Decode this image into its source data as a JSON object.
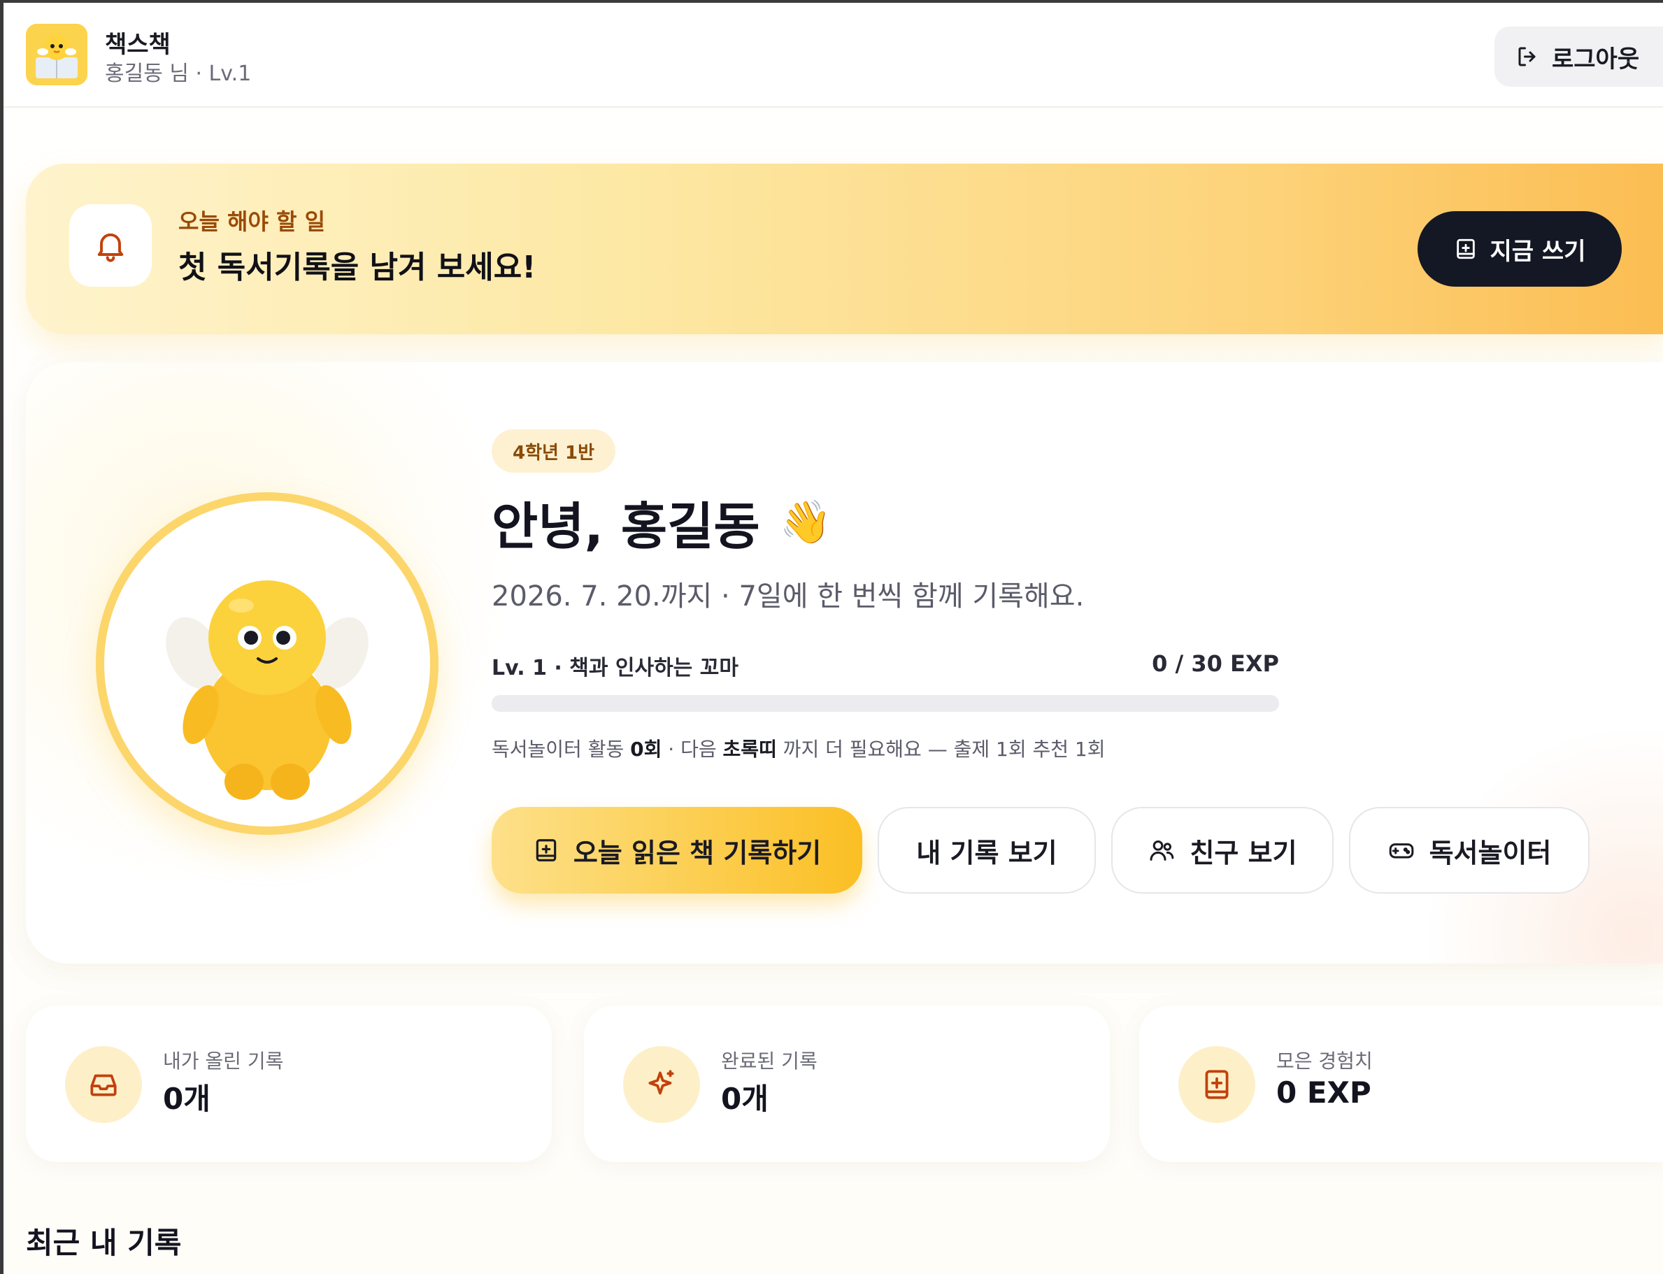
{
  "header": {
    "app_name": "책스책",
    "user_line": "홍길동 님 · Lv.1",
    "logout_label": "로그아웃"
  },
  "todo": {
    "kicker": "오늘 해야 할 일",
    "title": "첫 독서기록을 남겨 보세요!",
    "cta_label": "지금 쓰기"
  },
  "hero": {
    "class_chip": "4학년 1반",
    "greeting": "안녕, 홍길동",
    "greeting_emoji": "👋",
    "deadline": "2026. 7. 20.까지 · 7일에 한 번씩 함께 기록해요.",
    "level_label": "Lv. 1 · 책과 인사하는 꼬마",
    "exp_text": "0 / 30 EXP",
    "exp_current": 0,
    "exp_max": 30,
    "activity": {
      "prefix": "독서놀이터 활동 ",
      "count": "0회",
      "middle": " · 다음 ",
      "next_badge": "초록띠",
      "suffix": " 까지 더 필요해요 — 출제 1회 추천 1회"
    },
    "actions": {
      "record_today": "오늘 읽은 책 기록하기",
      "my_records": "내 기록 보기",
      "friends": "친구 보기",
      "playground": "독서놀이터"
    }
  },
  "stats": [
    {
      "label": "내가 올린 기록",
      "value": "0개",
      "icon": "inbox-icon"
    },
    {
      "label": "완료된 기록",
      "value": "0개",
      "icon": "sparkle-icon"
    },
    {
      "label": "모은 경험치",
      "value": "0 EXP",
      "icon": "book-plus-icon"
    }
  ],
  "recent": {
    "title": "최근 내 기록"
  },
  "colors": {
    "accent": "#fbbf24",
    "dark_button": "#141824",
    "chip_text": "#8a4b07"
  }
}
